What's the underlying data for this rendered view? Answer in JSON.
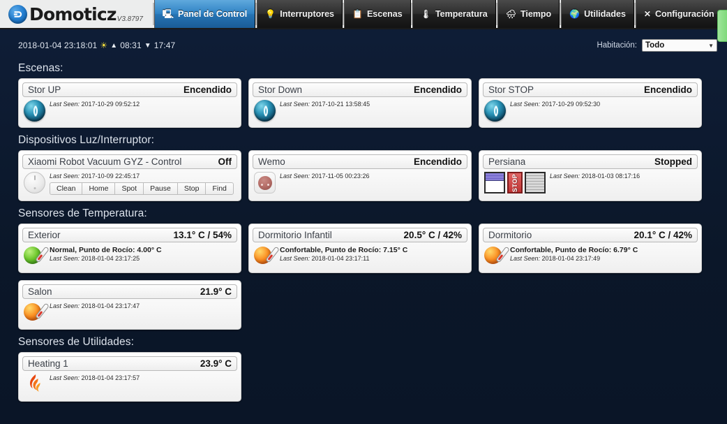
{
  "header": {
    "brand": "Domoticz",
    "version": "V3.8797",
    "nav": [
      {
        "label": "Panel de Control",
        "icon": "dashboard-icon",
        "active": true
      },
      {
        "label": "Interruptores",
        "icon": "bulb-icon",
        "active": false
      },
      {
        "label": "Escenas",
        "icon": "scenes-icon",
        "active": false
      },
      {
        "label": "Temperatura",
        "icon": "thermometer-icon",
        "active": false
      },
      {
        "label": "Tiempo",
        "icon": "weather-icon",
        "active": false
      },
      {
        "label": "Utilidades",
        "icon": "utilities-icon",
        "active": false
      },
      {
        "label": "Configuración",
        "icon": "wrench-icon",
        "active": false,
        "caret": "▾"
      }
    ]
  },
  "statusbar": {
    "datetime": "2018-01-04 23:18:01",
    "sun_icon": "☀",
    "sunrise_arrow": "▲",
    "sunrise": "08:31",
    "sunset_arrow": "▼",
    "sunset": "17:47",
    "room_label": "Habitación:",
    "room_value": "Todo",
    "room_options": [
      "Todo"
    ]
  },
  "sections": [
    {
      "title": "Escenas:",
      "cards": [
        {
          "name": "Stor UP",
          "status": "Encendido",
          "icon": "scene-toggle-icon",
          "lastseen_label": "Last Seen:",
          "lastseen": "2017-10-29 09:52:12"
        },
        {
          "name": "Stor Down",
          "status": "Encendido",
          "icon": "scene-toggle-icon",
          "lastseen_label": "Last Seen:",
          "lastseen": "2017-10-21 13:58:45"
        },
        {
          "name": "Stor STOP",
          "status": "Encendido",
          "icon": "scene-toggle-icon",
          "lastseen_label": "Last Seen:",
          "lastseen": "2017-10-29 09:52:30"
        }
      ]
    },
    {
      "title": "Dispositivos Luz/Interruptor:",
      "cards": [
        {
          "name": "Xiaomi Robot Vacuum GYZ - Control",
          "status": "Off",
          "icon": "vacuum-icon",
          "lastseen_label": "Last Seen:",
          "lastseen": "2017-10-09 22:45:17",
          "buttons": [
            "Clean",
            "Home",
            "Spot",
            "Pause",
            "Stop",
            "Find"
          ]
        },
        {
          "name": "Wemo",
          "status": "Encendido",
          "icon": "socket-icon",
          "lastseen_label": "Last Seen:",
          "lastseen": "2017-11-05 00:23:26"
        },
        {
          "name": "Persiana",
          "status": "Stopped",
          "icon": "blind-controls-icon",
          "lastseen_label": "Last Seen:",
          "lastseen": "2018-01-03 08:17:16",
          "blind_buttons": [
            "blind-up",
            "STOP",
            "blind-down"
          ]
        }
      ]
    },
    {
      "title": "Sensores de Temperatura:",
      "cards": [
        {
          "name": "Exterior",
          "status": "13.1° C / 54%",
          "icon": "thermometer-green-icon",
          "info": "Normal, Punto de Rocío: 4.00° C",
          "lastseen_label": "Last Seen:",
          "lastseen": "2018-01-04 23:17:25"
        },
        {
          "name": "Dormitorio Infantil",
          "status": "20.5° C / 42%",
          "icon": "thermometer-orange-icon",
          "info": "Confortable, Punto de Rocío: 7.15° C",
          "lastseen_label": "Last Seen:",
          "lastseen": "2018-01-04 23:17:11"
        },
        {
          "name": "Dormitorio",
          "status": "20.1° C / 42%",
          "icon": "thermometer-orange-icon",
          "info": "Confortable, Punto de Rocío: 6.79° C",
          "lastseen_label": "Last Seen:",
          "lastseen": "2018-01-04 23:17:49"
        },
        {
          "name": "Salon",
          "status": "21.9° C",
          "icon": "thermometer-orange-icon",
          "info": "",
          "lastseen_label": "Last Seen:",
          "lastseen": "2018-01-04 23:17:47"
        }
      ]
    },
    {
      "title": "Sensores de Utilidades:",
      "cards": [
        {
          "name": "Heating 1",
          "status": "23.9° C",
          "icon": "flame-icon",
          "info": "",
          "lastseen_label": "Last Seen:",
          "lastseen": "2018-01-04 23:17:57"
        }
      ]
    }
  ],
  "colors": {
    "background": "#0d1b33",
    "nav_active": "#3083c4",
    "nav_inactive": "#2e2e2e",
    "card_bg": "#f7f7f7",
    "heading": "#dde3ec",
    "green_tab": "#7fd87b"
  }
}
